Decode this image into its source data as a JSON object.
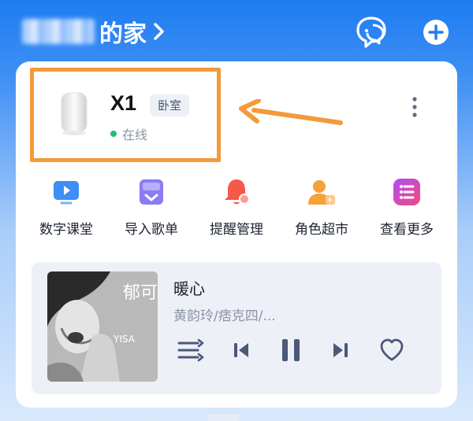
{
  "header": {
    "home_suffix": "的家",
    "chevron_icon": "chevron-right-icon",
    "chat_icon": "chat-bubbles-icon",
    "add_icon": "plus-circle-icon"
  },
  "device": {
    "name": "X1",
    "room": "卧室",
    "status": "在线",
    "status_color": "#2bbb74",
    "highlight_color": "#f39a3c"
  },
  "quick_actions": [
    {
      "label": "数字课堂",
      "icon": "classroom-screen-icon"
    },
    {
      "label": "导入歌单",
      "icon": "import-playlist-icon"
    },
    {
      "label": "提醒管理",
      "icon": "reminder-bell-icon"
    },
    {
      "label": "角色超市",
      "icon": "role-market-icon"
    },
    {
      "label": "查看更多",
      "icon": "more-list-icon"
    }
  ],
  "player": {
    "title": "暖心",
    "artist": "黄韵玲/痞克四/...",
    "album_text_main": "郁可唯",
    "album_text_sub": "YISA"
  },
  "colors": {
    "accent_blue": "#1e7cf2",
    "card_bg": "#ffffff",
    "player_bg": "#eef0f8"
  }
}
